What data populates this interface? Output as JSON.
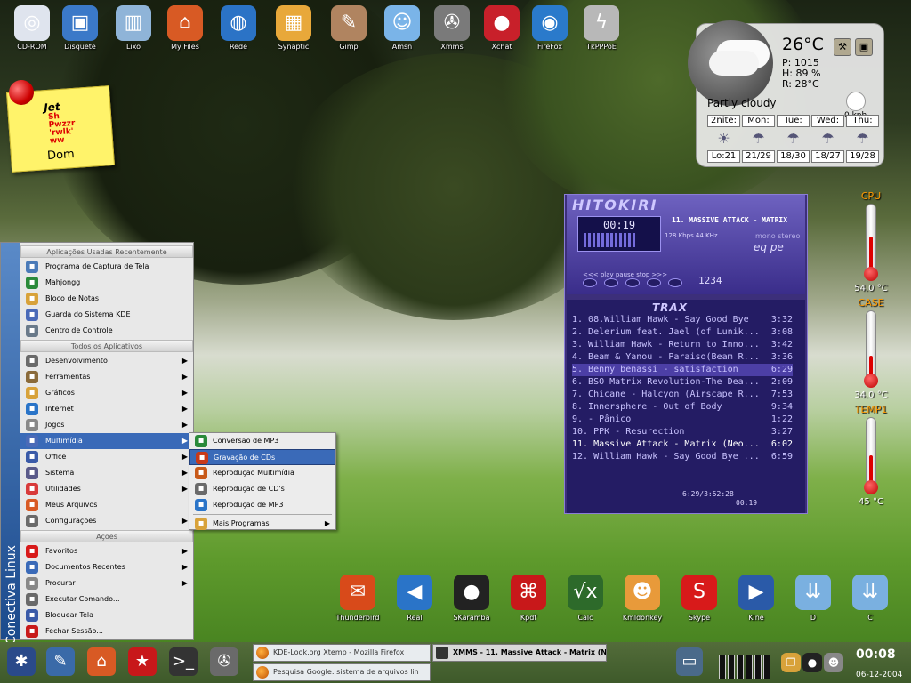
{
  "desktop_icons": [
    {
      "label": "CD-ROM",
      "icon": "cdrom-icon",
      "glyph": "◎",
      "color": "#dfe4ee"
    },
    {
      "label": "Disquete",
      "icon": "floppy-icon",
      "glyph": "▣",
      "color": "#3b79c8"
    },
    {
      "label": "Lixo",
      "icon": "trash-icon",
      "glyph": "▥",
      "color": "#8fb4d8"
    },
    {
      "label": "My Files",
      "icon": "home-folder-icon",
      "glyph": "⌂",
      "color": "#d85a24"
    },
    {
      "label": "Rede",
      "icon": "network-icon",
      "glyph": "◍",
      "color": "#2b73c6"
    },
    {
      "label": "Synaptic",
      "icon": "package-icon",
      "glyph": "▦",
      "color": "#e8a83a"
    },
    {
      "label": "Gimp",
      "icon": "gimp-icon",
      "glyph": "✎",
      "color": "#b08460"
    },
    {
      "label": "Amsn",
      "icon": "amsn-icon",
      "glyph": "☺",
      "color": "#7ab4e8"
    },
    {
      "label": "Xmms",
      "icon": "xmms-icon",
      "glyph": "✇",
      "color": "#7a7a7a"
    },
    {
      "label": "Xchat",
      "icon": "xchat-icon",
      "glyph": "●",
      "color": "#c8202a"
    },
    {
      "label": "FireFox",
      "icon": "firefox-icon",
      "glyph": "◉",
      "color": "#2a7acb"
    },
    {
      "label": "TkPPPoE",
      "icon": "modem-icon",
      "glyph": "ϟ",
      "color": "#b8b8b8"
    }
  ],
  "note": {
    "title": "Jet",
    "scribble": "Sh Pwzzr 'rwlk' ww",
    "text": "Dom"
  },
  "weather": {
    "temp": "26°C",
    "pressure": "P: 1015",
    "humidity": "H: 89 %",
    "real": "R: 28°C",
    "wind": "0 kph",
    "condition": "Partly cloudy",
    "days": [
      {
        "name": "2nite:",
        "temps": "Lo:21",
        "icon": "☀"
      },
      {
        "name": "Mon:",
        "temps": "21/29",
        "icon": "☂"
      },
      {
        "name": "Tue:",
        "temps": "18/30",
        "icon": "☂"
      },
      {
        "name": "Wed:",
        "temps": "18/27",
        "icon": "☂"
      },
      {
        "name": "Thu:",
        "temps": "19/28",
        "icon": "☂"
      }
    ]
  },
  "sensors": [
    {
      "label": "CPU",
      "value": "54.0 °C",
      "level": 0.54
    },
    {
      "label": "CASE",
      "value": "34.0 °C",
      "level": 0.34
    },
    {
      "label": "TEMP1",
      "value": "45 °C",
      "level": 0.45
    }
  ],
  "xmms": {
    "logo": "HITOKIRI",
    "time": "00:19",
    "song": "11. MASSIVE ATTACK - MATRIX",
    "kbps": "128 Kbps    44 KHz",
    "monostereo": "mono stereo",
    "eqpl": "eq pe",
    "controls": "<<<   play  pause  stop  >>>",
    "track_numbers": "1234",
    "playlist_title": "TRAX",
    "playlist": [
      {
        "title": "1. 08.William Hawk - Say Good Bye",
        "time": "3:32"
      },
      {
        "title": "2. Delerium feat. Jael (of Lunik...",
        "time": "3:08"
      },
      {
        "title": "3. William Hawk - Return to Inno...",
        "time": "3:42"
      },
      {
        "title": "4. Beam & Yanou - Paraiso(Beam R...",
        "time": "3:36"
      },
      {
        "title": "5. Benny benassi - satisfaction",
        "time": "6:29"
      },
      {
        "title": "6. BSO Matrix Revolution-The Dea...",
        "time": "2:09"
      },
      {
        "title": "7. Chicane - Halcyon (Airscape R...",
        "time": "7:53"
      },
      {
        "title": "8. Innersphere - Out of Body",
        "time": "9:34"
      },
      {
        "title": "9.  - Pânico",
        "time": "1:22"
      },
      {
        "title": "10. PPK - Resurection",
        "time": "3:27"
      },
      {
        "title": "11. Massive Attack - Matrix (Neo...",
        "time": "6:02"
      },
      {
        "title": "12. William Hawk - Say Good Bye ...",
        "time": "6:59"
      }
    ],
    "selected_index": 4,
    "current_index": 10,
    "total": "6:29/3:52:28",
    "pos": "00:19"
  },
  "dock": [
    {
      "label": "Thunderbird",
      "icon": "thunderbird-icon",
      "glyph": "✉",
      "color": "#d84a1a"
    },
    {
      "label": "Real",
      "icon": "realplayer-icon",
      "glyph": "◀",
      "color": "#2a74c8"
    },
    {
      "label": "SKaramba",
      "icon": "superkaramba-icon",
      "glyph": "●",
      "color": "#222"
    },
    {
      "label": "Kpdf",
      "icon": "kpdf-icon",
      "glyph": "⌘",
      "color": "#c8181a"
    },
    {
      "label": "Calc",
      "icon": "calc-icon",
      "glyph": "√x",
      "color": "#2d6a2a"
    },
    {
      "label": "Kmldonkey",
      "icon": "kmldonkey-icon",
      "glyph": "☻",
      "color": "#e89a3a"
    },
    {
      "label": "Skype",
      "icon": "skype-icon",
      "glyph": "S",
      "color": "#d81a1a"
    },
    {
      "label": "Kine",
      "icon": "kino-icon",
      "glyph": "▶",
      "color": "#2a5aa8"
    },
    {
      "label": "D",
      "icon": "drive-d-icon",
      "glyph": "⇊",
      "color": "#7ab0e0"
    },
    {
      "label": "C",
      "icon": "drive-c-icon",
      "glyph": "⇊",
      "color": "#7ab0e0"
    }
  ],
  "kmenu": {
    "side_title": "Conectiva Linux",
    "recent_header": "Aplicações Usadas Recentemente",
    "recent": [
      {
        "label": "Programa de Captura de Tela",
        "icon": "screenshot-icon",
        "color": "#4a7ab8"
      },
      {
        "label": "Mahjongg",
        "icon": "mahjongg-icon",
        "color": "#2a8a3a"
      },
      {
        "label": "Bloco de Notas",
        "icon": "notepad-icon",
        "color": "#d8a23a"
      },
      {
        "label": "Guarda do Sistema KDE",
        "icon": "ksysguard-icon",
        "color": "#4a6ab8"
      },
      {
        "label": "Centro de Controle",
        "icon": "control-center-icon",
        "color": "#6a7a8a"
      }
    ],
    "all_header": "Todos os Aplicativos",
    "apps": [
      {
        "label": "Desenvolvimento",
        "icon": "development-icon",
        "color": "#6a6a6a",
        "arrow": "▶"
      },
      {
        "label": "Ferramentas",
        "icon": "tools-icon",
        "color": "#8a6a3a",
        "arrow": "▶"
      },
      {
        "label": "Gráficos",
        "icon": "graphics-icon",
        "color": "#d8a23a",
        "arrow": "▶"
      },
      {
        "label": "Internet",
        "icon": "internet-icon",
        "color": "#2a74c8",
        "arrow": "▶"
      },
      {
        "label": "Jogos",
        "icon": "games-icon",
        "color": "#888",
        "arrow": "▶"
      },
      {
        "label": "Multimídia",
        "icon": "multimedia-icon",
        "color": "#4a6ab8",
        "arrow": "▶"
      },
      {
        "label": "Office",
        "icon": "office-icon",
        "color": "#3a5aa8",
        "arrow": "▶"
      },
      {
        "label": "Sistema",
        "icon": "system-icon",
        "color": "#5a5a8a",
        "arrow": "▶"
      },
      {
        "label": "Utilidades",
        "icon": "utilities-icon",
        "color": "#d83a3a",
        "arrow": "▶"
      },
      {
        "label": "Meus Arquivos",
        "icon": "my-files-icon",
        "color": "#d85a24",
        "arrow": ""
      },
      {
        "label": "Configurações",
        "icon": "settings-icon",
        "color": "#6a6a6a",
        "arrow": "▶"
      }
    ],
    "actions_header": "Ações",
    "actions": [
      {
        "label": "Favoritos",
        "icon": "favorites-icon",
        "color": "#d81a1a",
        "arrow": "▶"
      },
      {
        "label": "Documentos Recentes",
        "icon": "recent-docs-icon",
        "color": "#3a6ab8",
        "arrow": "▶"
      },
      {
        "label": "Procurar",
        "icon": "find-icon",
        "color": "#888",
        "arrow": "▶"
      },
      {
        "label": "Executar Comando...",
        "icon": "run-icon",
        "color": "#6a6a6a",
        "arrow": ""
      },
      {
        "label": "Bloquear Tela",
        "icon": "lock-icon",
        "color": "#3a5aa8",
        "arrow": ""
      },
      {
        "label": "Fechar Sessão...",
        "icon": "logout-icon",
        "color": "#c81a1a",
        "arrow": ""
      }
    ]
  },
  "submenu": [
    {
      "label": "Conversão de MP3",
      "icon": "mp3-convert-icon",
      "color": "#2a8a3a",
      "arrow": ""
    },
    {
      "label": "Gravação de CDs",
      "icon": "cd-burn-icon",
      "color": "#c83a1a",
      "arrow": ""
    },
    {
      "label": "Reprodução Multimídia",
      "icon": "media-player-icon",
      "color": "#c85a1a",
      "arrow": ""
    },
    {
      "label": "Reprodução de CD's",
      "icon": "cd-player-icon",
      "color": "#6a6a6a",
      "arrow": ""
    },
    {
      "label": "Reprodução de MP3",
      "icon": "mp3-player-icon",
      "color": "#2a74c8",
      "arrow": ""
    },
    {
      "label": "Mais Programas",
      "icon": "more-programs-icon",
      "color": "#d8a23a",
      "arrow": "▶"
    }
  ],
  "taskbar": {
    "tasks": [
      {
        "label": "KDE-Look.org  Xtemp - Mozilla Firefox"
      },
      {
        "label": "Pesquisa Google: sistema de arquivos lin"
      },
      {
        "label": "XMMS - 11. Massive Attack - Matrix (N"
      }
    ],
    "clock": "00:08",
    "date": "06-12-2004"
  }
}
